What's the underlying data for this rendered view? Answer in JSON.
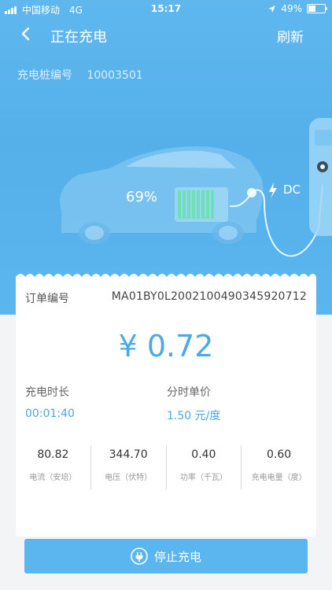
{
  "status_bar": {
    "carrier": "中国移动",
    "network": "4G",
    "time": "15:17",
    "battery": "49%"
  },
  "nav": {
    "title": "正在充电",
    "refresh": "刷新"
  },
  "pile": {
    "label": "充电桩编号",
    "value": "10003501"
  },
  "charge": {
    "percent": "69%",
    "mode": "DC"
  },
  "order": {
    "label": "订单编号",
    "value": "MA01BY0L2002100490345920712"
  },
  "amount": "¥ 0.72",
  "duration": {
    "label": "充电时长",
    "value": "00:01:40"
  },
  "unit_price": {
    "label": "分时单价",
    "value": "1.50 元/度"
  },
  "stats": [
    {
      "value": "80.82",
      "caption": "电流（安培）"
    },
    {
      "value": "344.70",
      "caption": "电压（伏特）"
    },
    {
      "value": "0.40",
      "caption": "功率（千瓦）"
    },
    {
      "value": "0.60",
      "caption": "充电电量（度）"
    }
  ],
  "stop_button": "停止充电",
  "icons": {
    "back": "chevron-left-icon",
    "bolt": "lightning-bolt-icon",
    "plug": "plug-icon",
    "location": "location-arrow-icon"
  }
}
